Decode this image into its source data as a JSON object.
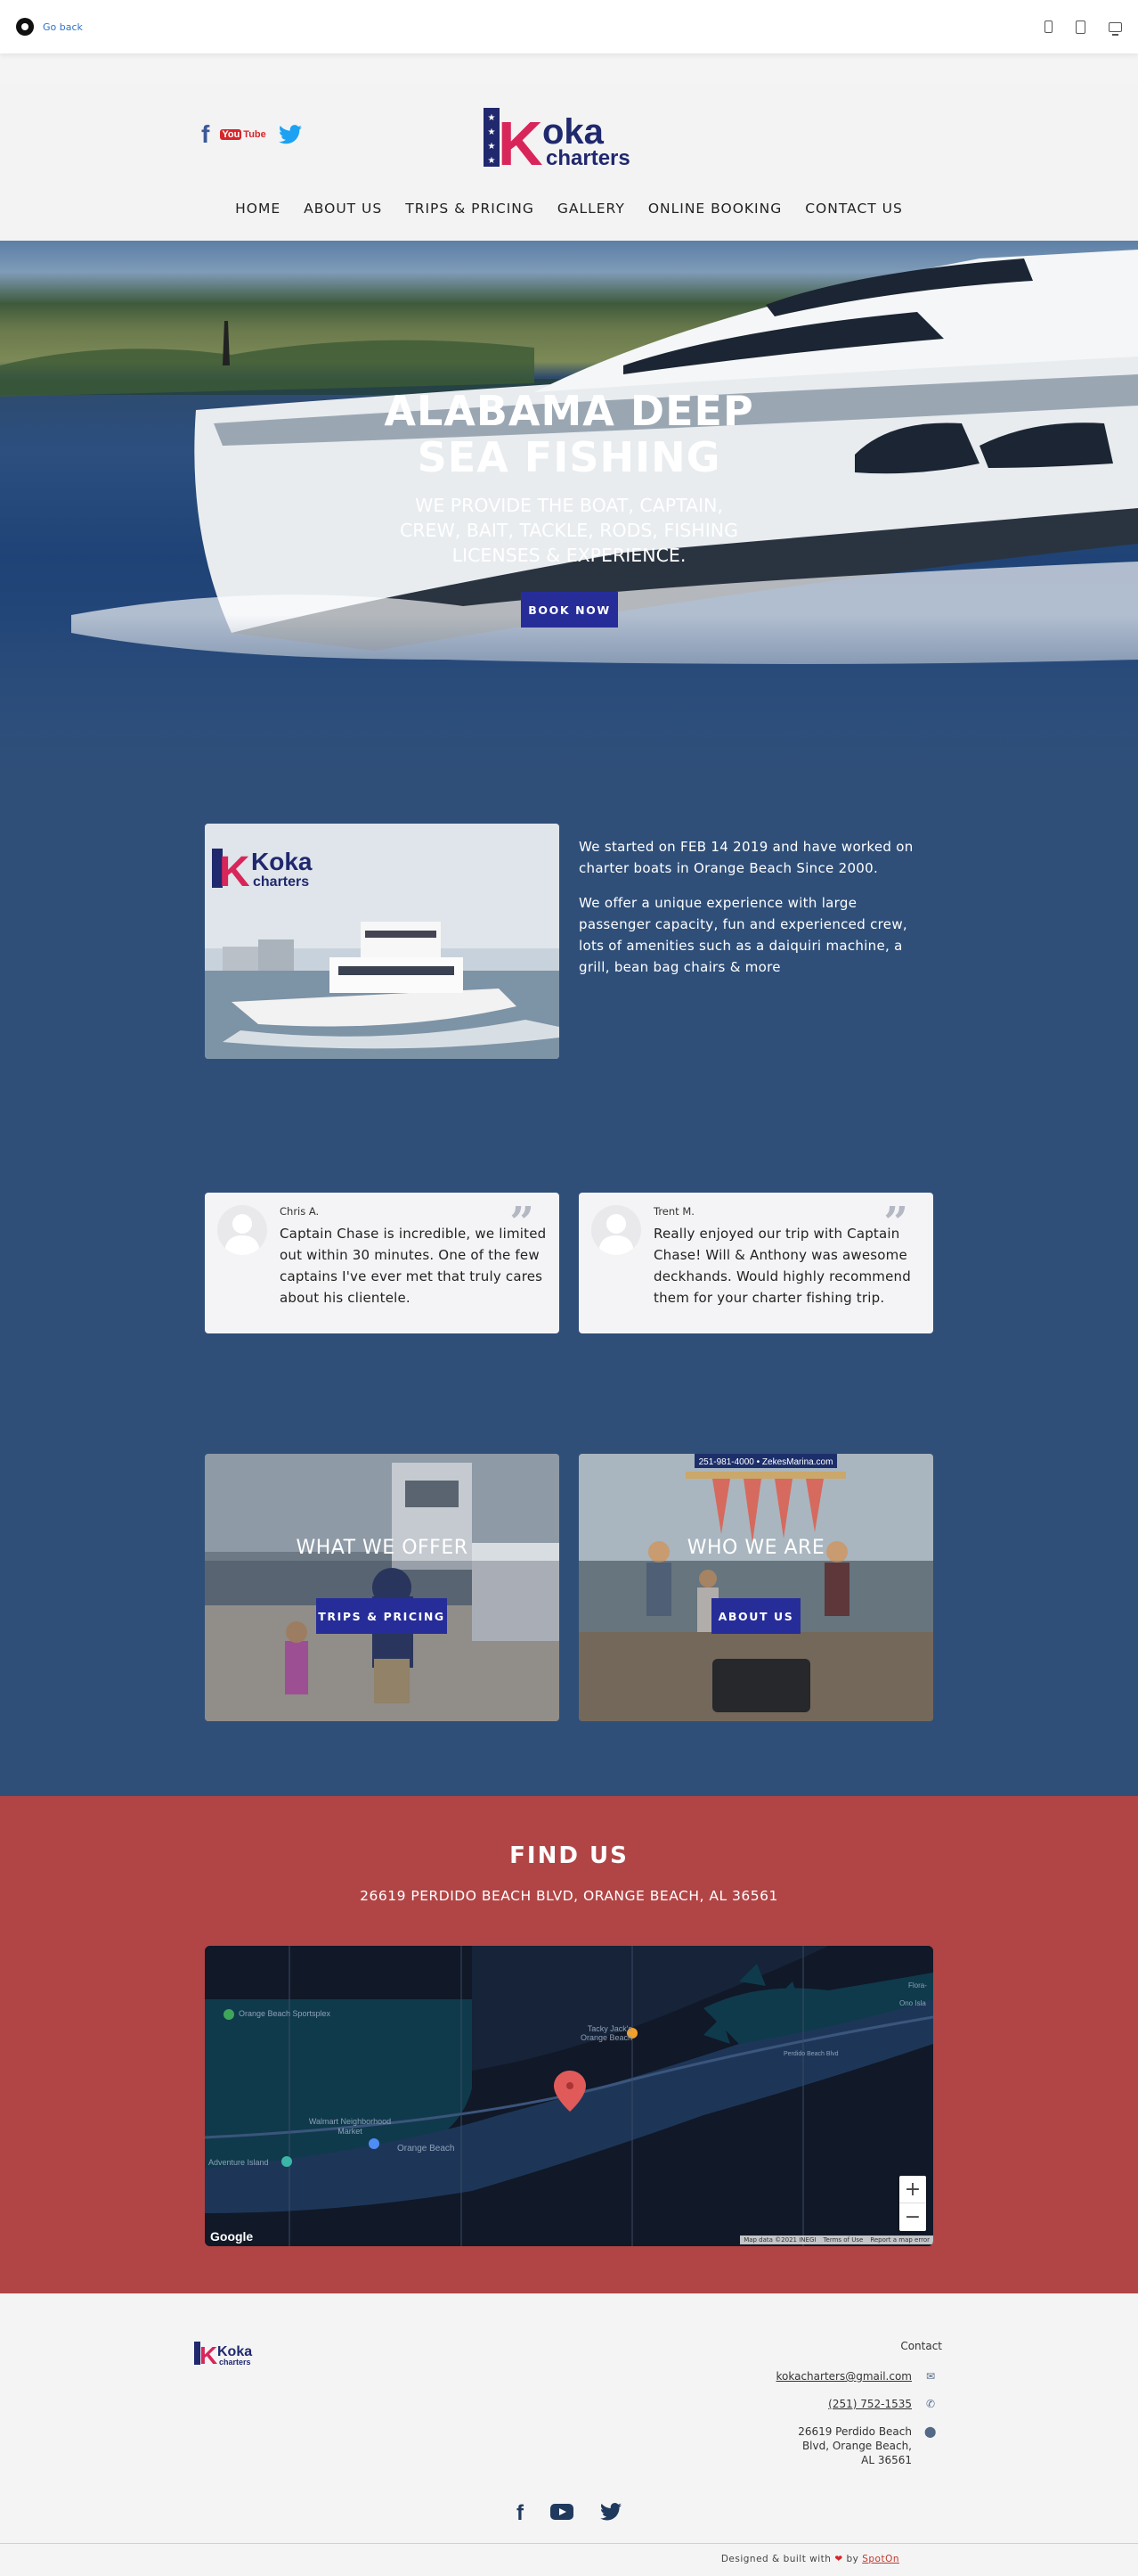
{
  "preview_bar": {
    "go_back": "Go back"
  },
  "header": {
    "logo": {
      "brand": "Koka",
      "tagline": "charters"
    },
    "social": [
      "facebook-icon",
      "youtube-icon",
      "twitter-icon"
    ],
    "youtube_text": "You",
    "youtube_tube": "Tube",
    "nav": [
      "HOME",
      "ABOUT US",
      "TRIPS & PRICING",
      "GALLERY",
      "ONLINE BOOKING",
      "CONTACT US"
    ]
  },
  "hero": {
    "title_line1": "ALABAMA DEEP",
    "title_line2": "SEA FISHING",
    "subtitle": "WE PROVIDE THE BOAT, CAPTAIN, CREW, BAIT, TACKLE, RODS, FISHING LICENSES & EXPERIENCE.",
    "cta": "BOOK NOW"
  },
  "about": {
    "image_logo": "Koka",
    "image_logo_tagline": "charters",
    "paragraph1": "We started on FEB 14 2019 and have worked on charter boats in Orange Beach Since 2000.",
    "paragraph2": "We offer a unique experience with large passenger capacity, fun and experienced crew, lots of amenities such as a daiquiri machine, a grill, bean bag chairs & more"
  },
  "reviews": [
    {
      "name": "Chris A.",
      "text": "Captain Chase is incredible, we limited out within 30 minutes. One of the few captains I've ever met that truly cares about his clientele."
    },
    {
      "name": "Trent M.",
      "text": "Really enjoyed our trip with Captain Chase! Will & Anthony was awesome deckhands. Would highly recommend them for your charter fishing trip."
    }
  ],
  "cards": [
    {
      "title": "WHAT WE OFFER",
      "button": "TRIPS & PRICING"
    },
    {
      "title": "WHO WE ARE",
      "button": "ABOUT US",
      "sign": "251-981-4000 • ZekesMarina.com"
    }
  ],
  "find_us": {
    "title": "FIND US",
    "address": "26619 PERDIDO BEACH BLVD, ORANGE BEACH, AL 36561",
    "map": {
      "labels": {
        "sportsplex": "Orange Beach Sportsplex",
        "tacky_jacks": "Tacky Jack's Orange Beach",
        "walmart": "Walmart Neighborhood Market",
        "orange_beach": "Orange Beach",
        "adventure_island": "Adventure Island",
        "perdido_beach": "Perdido Beach Blvd",
        "ono_island": "Ono Isla",
        "flora": "Flora-"
      },
      "logo": "Google",
      "zoom_in": "+",
      "zoom_out": "−",
      "attribution": [
        "Map data ©2021 INEGI",
        "Terms of Use",
        "Report a map error"
      ]
    }
  },
  "footer": {
    "logo": {
      "brand": "Koka",
      "tagline": "charters"
    },
    "contact_heading": "Contact",
    "email": "kokacharters@gmail.com",
    "phone": "(251) 752-1535",
    "address_line1": "26619 Perdido Beach",
    "address_line2": "Blvd, Orange Beach,",
    "address_line3": "AL 36561",
    "social": [
      "facebook-icon",
      "youtube-icon",
      "twitter-icon"
    ],
    "built_prefix": "Designed & built with",
    "built_by": "by",
    "built_link": "SpotOn"
  },
  "colors": {
    "nav_blue": "#262d99",
    "body_blue": "#2f4f79",
    "find_us_red": "#b14546",
    "logo_pink": "#d8265a",
    "logo_navy": "#20286e"
  }
}
